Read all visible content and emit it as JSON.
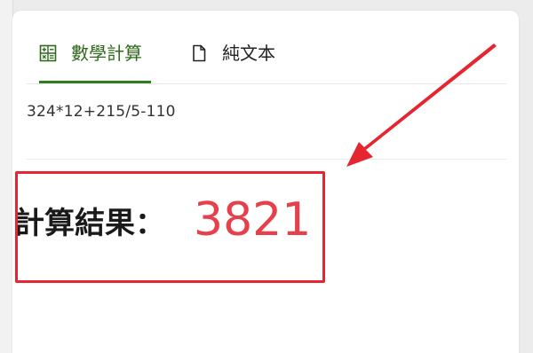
{
  "tabs": [
    {
      "label": "數學計算",
      "icon": "calculator-icon",
      "active": true
    },
    {
      "label": "純文本",
      "icon": "document-icon",
      "active": false
    }
  ],
  "input": {
    "value": "324*12+215/5-110"
  },
  "result": {
    "label": "計算結果：",
    "value": "3821"
  },
  "colors": {
    "accent": "#2e7d1f",
    "result": "#e8404a",
    "annotation": "#e52631"
  }
}
